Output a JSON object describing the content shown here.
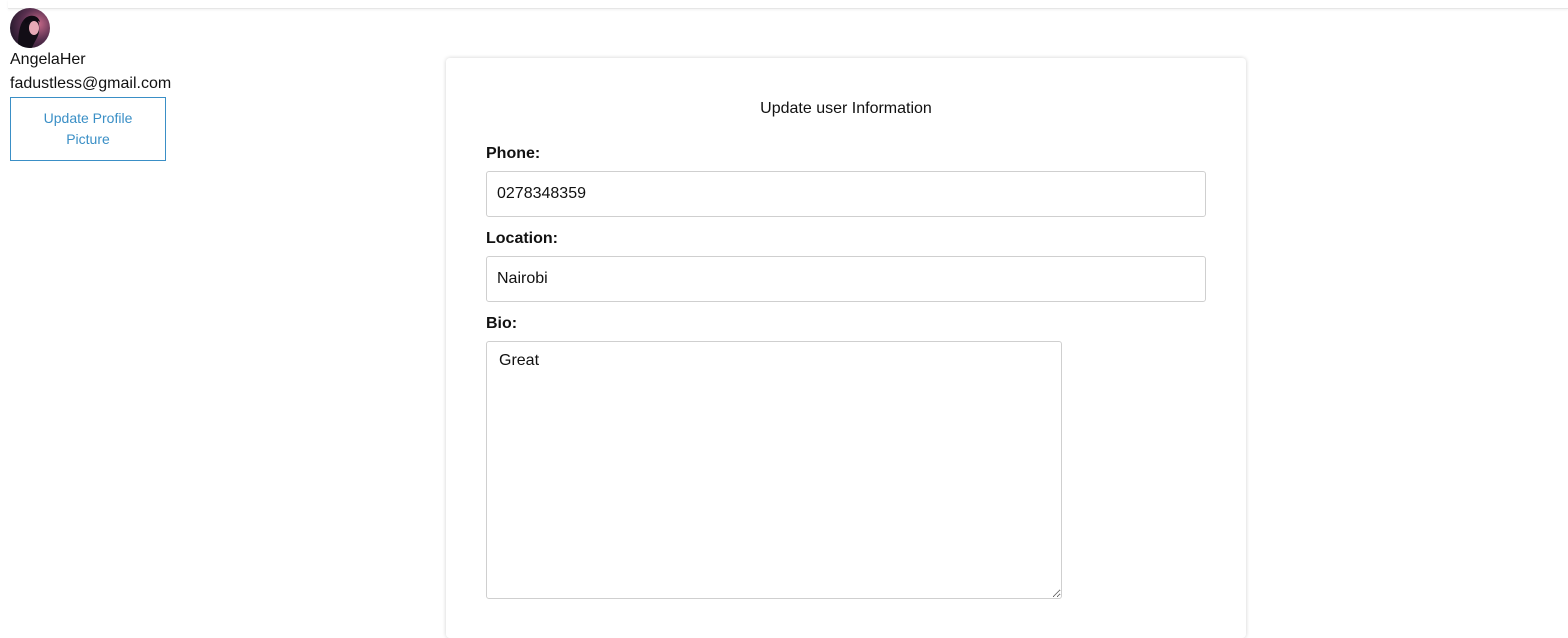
{
  "profile": {
    "username": "AngelaHer",
    "email": "fadustless@gmail.com",
    "update_picture_label": "Update Profile Picture",
    "avatar_icon": "user-avatar"
  },
  "form": {
    "title": "Update user Information",
    "phone": {
      "label": "Phone:",
      "value": "0278348359"
    },
    "location": {
      "label": "Location:",
      "value": "Nairobi"
    },
    "bio": {
      "label": "Bio:",
      "value": "Great"
    }
  },
  "colors": {
    "accent": "#3a8fc6",
    "input_border": "#cfcfcf"
  }
}
